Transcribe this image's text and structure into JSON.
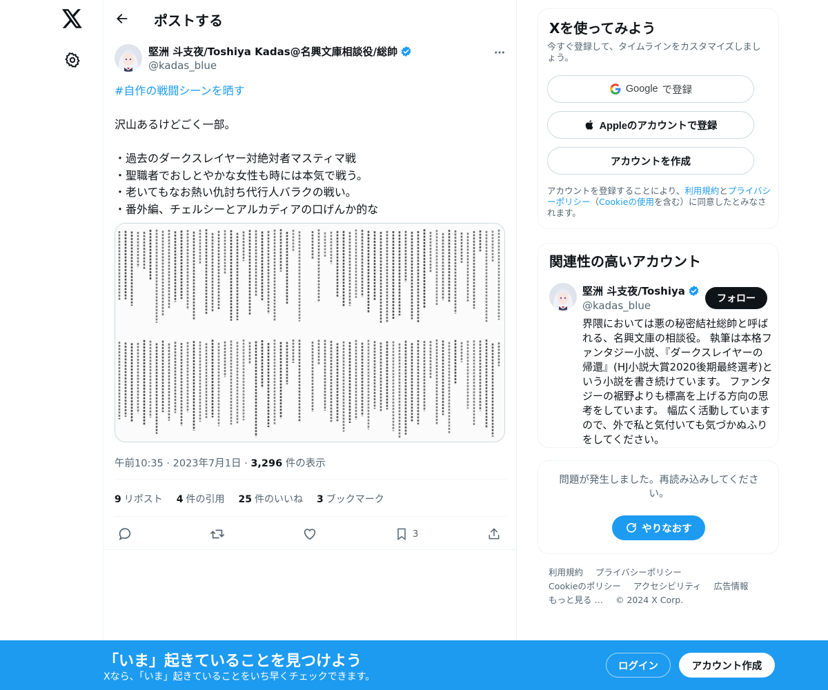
{
  "nav": {
    "logo_icon": "x-logo-icon",
    "settings_icon": "gear-icon"
  },
  "header": {
    "title": "ポストする",
    "back_icon": "arrow-left-icon"
  },
  "post": {
    "author_name": "堅洲 斗支夜/Toshiya Kadas@名興文庫相談役/総帥",
    "author_handle": "@kadas_blue",
    "hashtag": "#自作の戦闘シーンを晒す",
    "body": "\n\n沢山あるけどごく一部。\n\n・過去のダークスレイヤー対絶対者マスティマ戦\n・聖職者でおしとやかな女性も時には本気で戦う。\n・老いてもなお熱い仇討ち代行人バラクの戦い。\n・番外編、チェルシーとアルカディアの口げんか的な",
    "time": "午前10:35",
    "sep": "·",
    "date": "2023年7月1日",
    "views_count": "3,296",
    "views_label": "件の表示",
    "stats": {
      "reposts_count": "9",
      "reposts_label": "リポスト",
      "quotes_count": "4",
      "quotes_label": "件の引用",
      "likes_count": "25",
      "likes_label": "件のいいね",
      "bookmarks_count": "3",
      "bookmarks_label": "ブックマーク"
    },
    "actions": {
      "bookmark_count": "3"
    }
  },
  "signup": {
    "title": "Xを使ってみよう",
    "subtitle": "今すぐ登録して、タイムラインをカスタマイズしましょう。",
    "google_bold": "Google",
    "google_rest": "で登録",
    "apple_label": "Appleのアカウントで登録",
    "create_label": "アカウントを作成",
    "legal_1": "アカウントを登録することにより、",
    "legal_terms": "利用規約",
    "legal_2": "と",
    "legal_privacy": "プライバシーポリシー",
    "legal_3": "（",
    "legal_cookie": "Cookieの使用",
    "legal_4": "を含む）に同意したとみなされます。"
  },
  "related": {
    "title": "関連性の高いアカウント",
    "name": "堅洲 斗支夜/Toshiya",
    "handle": "@kadas_blue",
    "follow_label": "フォロー",
    "bio": "界隈においては悪の秘密結社総帥と呼ばれる、名興文庫の相談役。 執筆は本格ファンタジー小説、『ダークスレイヤーの帰還』(HJ小説大賞2020後期最終選考)という小説を書き続けています。 ファンタジーの裾野よりも標高を上げる方向の思考をしています。 幅広く活動していますので、外で私と気付いても気づかぬふりをしてください。"
  },
  "error": {
    "message": "問題が発生しました。再読み込みしてください。",
    "retry_label": "やりなおす"
  },
  "footer": {
    "links": [
      "利用規約",
      "プライバシーポリシー",
      "Cookieのポリシー",
      "アクセシビリティ",
      "広告情報",
      "もっと見る …"
    ],
    "copyright": "© 2024 X Corp."
  },
  "banner": {
    "title": "「いま」起きていることを見つけよう",
    "subtitle": "Xなら、「いま」起きていることをいち早くチェックできます。",
    "login_label": "ログイン",
    "create_label": "アカウント作成"
  },
  "colors": {
    "accent": "#1d9bf0",
    "text": "#0f1419",
    "muted": "#536471"
  }
}
